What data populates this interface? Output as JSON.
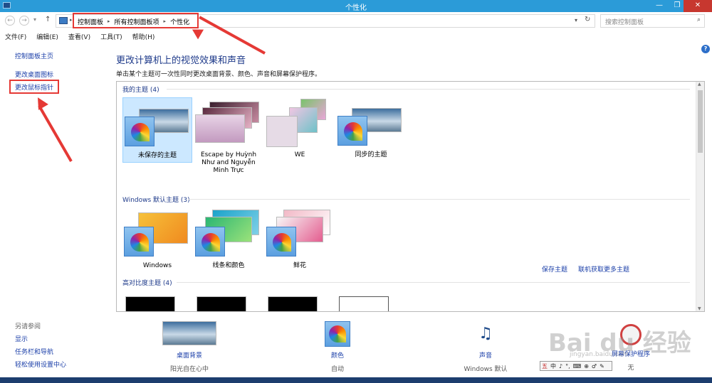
{
  "window": {
    "title": "个性化",
    "minimize": "—",
    "maximize": "❐",
    "close": "✕"
  },
  "nav": {
    "back": "←",
    "forward": "→",
    "up": "↑",
    "dropdown": "▾",
    "refresh": "↻"
  },
  "breadcrumb": [
    "控制面板",
    "所有控制面板项",
    "个性化"
  ],
  "search": {
    "placeholder": "搜索控制面板"
  },
  "menu": [
    "文件(F)",
    "编辑(E)",
    "查看(V)",
    "工具(T)",
    "帮助(H)"
  ],
  "sidebar": {
    "home": "控制面板主页",
    "items": [
      "更改桌面图标",
      "更改鼠标指针"
    ]
  },
  "main": {
    "title": "更改计算机上的视觉效果和声音",
    "subtitle": "单击某个主题可一次性同时更改桌面背景、颜色、声音和屏幕保护程序。"
  },
  "my_themes": {
    "header": "我的主题 (4)",
    "items": [
      "未保存的主题",
      "Escape by Huỳnh Như and Nguyễn Minh Trực",
      "WE",
      "同步的主题"
    ],
    "save_link": "保存主题",
    "online_link": "联机获取更多主题"
  },
  "windows_themes": {
    "header": "Windows 默认主题 (3)",
    "items": [
      "Windows",
      "线条和颜色",
      "鲜花"
    ]
  },
  "contrast_themes": {
    "header": "高对比度主题 (4)"
  },
  "see_also": {
    "header": "另请参阅",
    "items": [
      "显示",
      "任务栏和导航",
      "轻松使用设置中心"
    ]
  },
  "bottom": [
    {
      "label": "桌面背景",
      "value": "阳光自在心中"
    },
    {
      "label": "颜色",
      "value": "自动"
    },
    {
      "label": "声音",
      "value": "Windows 默认"
    },
    {
      "label": "屏幕保护程序",
      "value": "无"
    }
  ],
  "ime": [
    "五",
    "中",
    "♪",
    "°,",
    "⌨",
    "⊕",
    "♂",
    "✎"
  ],
  "watermark": {
    "main": "Bai du 经验",
    "sub": "jingyan.baidu.com"
  },
  "colors": {
    "accent": "#2b9bd8",
    "link": "#1a3ea8",
    "highlight": "#e53935"
  }
}
